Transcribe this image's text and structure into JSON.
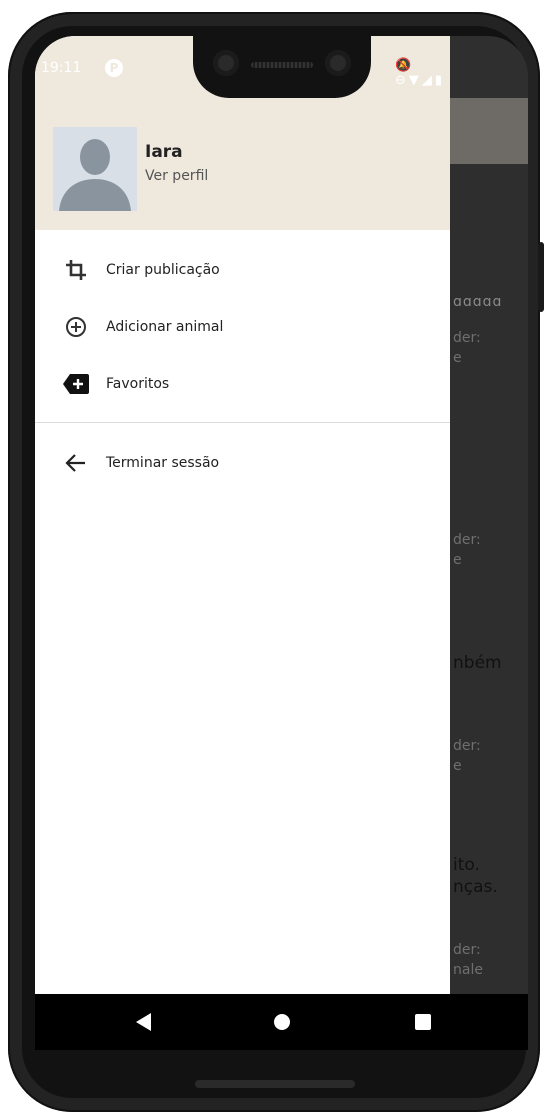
{
  "status_bar": {
    "time": "19:11",
    "badge": "P",
    "icons": [
      "notification-off-icon",
      "do-not-disturb-icon",
      "wifi-icon",
      "signal-icon",
      "battery-icon"
    ]
  },
  "drawer": {
    "user": {
      "name": "Iara",
      "link": "Ver perfil"
    },
    "items": [
      {
        "label": "Criar publicação",
        "icon": "crop-icon"
      },
      {
        "label": "Adicionar animal",
        "icon": "add-circle-icon"
      },
      {
        "label": "Favoritos",
        "icon": "favorite-tag-icon"
      },
      {
        "label": "Terminar sessão",
        "icon": "arrow-back-icon"
      }
    ]
  },
  "background": {
    "fragments": [
      "ɑɑɑɑɑ",
      "der:\ne",
      "der:\ne",
      "nbém",
      "der:\ne",
      "ito.\nnças.",
      "der:\nnale"
    ]
  },
  "colors": {
    "header_bg": "#efe8dd",
    "app_bar": "#6e6a66",
    "scrim": "#2e2e2e",
    "nav_bar": "#000000"
  }
}
